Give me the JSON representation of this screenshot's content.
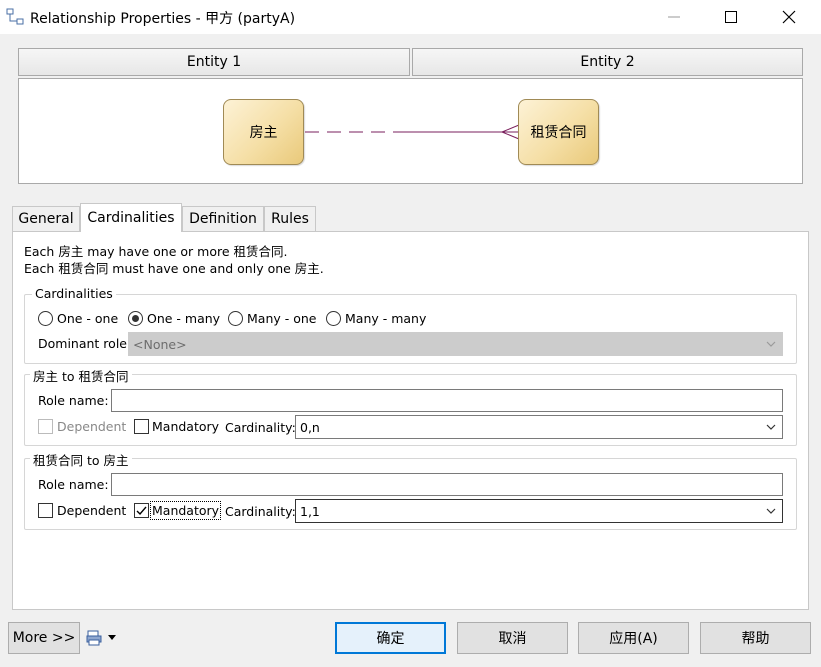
{
  "window": {
    "title": "Relationship Properties - 甲方 (partyA)",
    "icon": "relationship-icon"
  },
  "entities": {
    "entity1_header": "Entity 1",
    "entity2_header": "Entity 2",
    "entity1_name": "房主",
    "entity2_name": "租赁合同"
  },
  "tabs": [
    {
      "label": "General",
      "active": false
    },
    {
      "label": "Cardinalities",
      "active": true
    },
    {
      "label": "Definition",
      "active": false
    },
    {
      "label": "Rules",
      "active": false
    }
  ],
  "description": {
    "line1": "Each 房主 may have one or more 租赁合同.",
    "line2": "Each 租赁合同 must have one and only one 房主."
  },
  "cardinalities": {
    "legend": "Cardinalities",
    "options": [
      {
        "label": "One - one",
        "checked": false
      },
      {
        "label": "One - many",
        "checked": true
      },
      {
        "label": "Many - one",
        "checked": false
      },
      {
        "label": "Many - many",
        "checked": false
      }
    ],
    "dominant_label": "Dominant role:",
    "dominant_value": "<None>"
  },
  "role1": {
    "legend": "房主 to 租赁合同",
    "role_name_label": "Role name:",
    "role_name_value": "",
    "dependent_label": "Dependent",
    "dependent_checked": false,
    "mandatory_label": "Mandatory",
    "mandatory_checked": false,
    "cardinality_label": "Cardinality:",
    "cardinality_value": "0,n"
  },
  "role2": {
    "legend": "租赁合同 to 房主",
    "role_name_label": "Role name:",
    "role_name_value": "",
    "dependent_label": "Dependent",
    "dependent_checked": false,
    "mandatory_label": "Mandatory",
    "mandatory_checked": true,
    "cardinality_label": "Cardinality:",
    "cardinality_value": "1,1"
  },
  "footer": {
    "more": "More >>",
    "ok": "确定",
    "cancel": "取消",
    "apply": "应用(A)",
    "help": "帮助"
  },
  "colors": {
    "relationship_line": "#7a1f5c",
    "accent_focus": "#0078d7",
    "entity_fill": "#f5dfa6"
  }
}
